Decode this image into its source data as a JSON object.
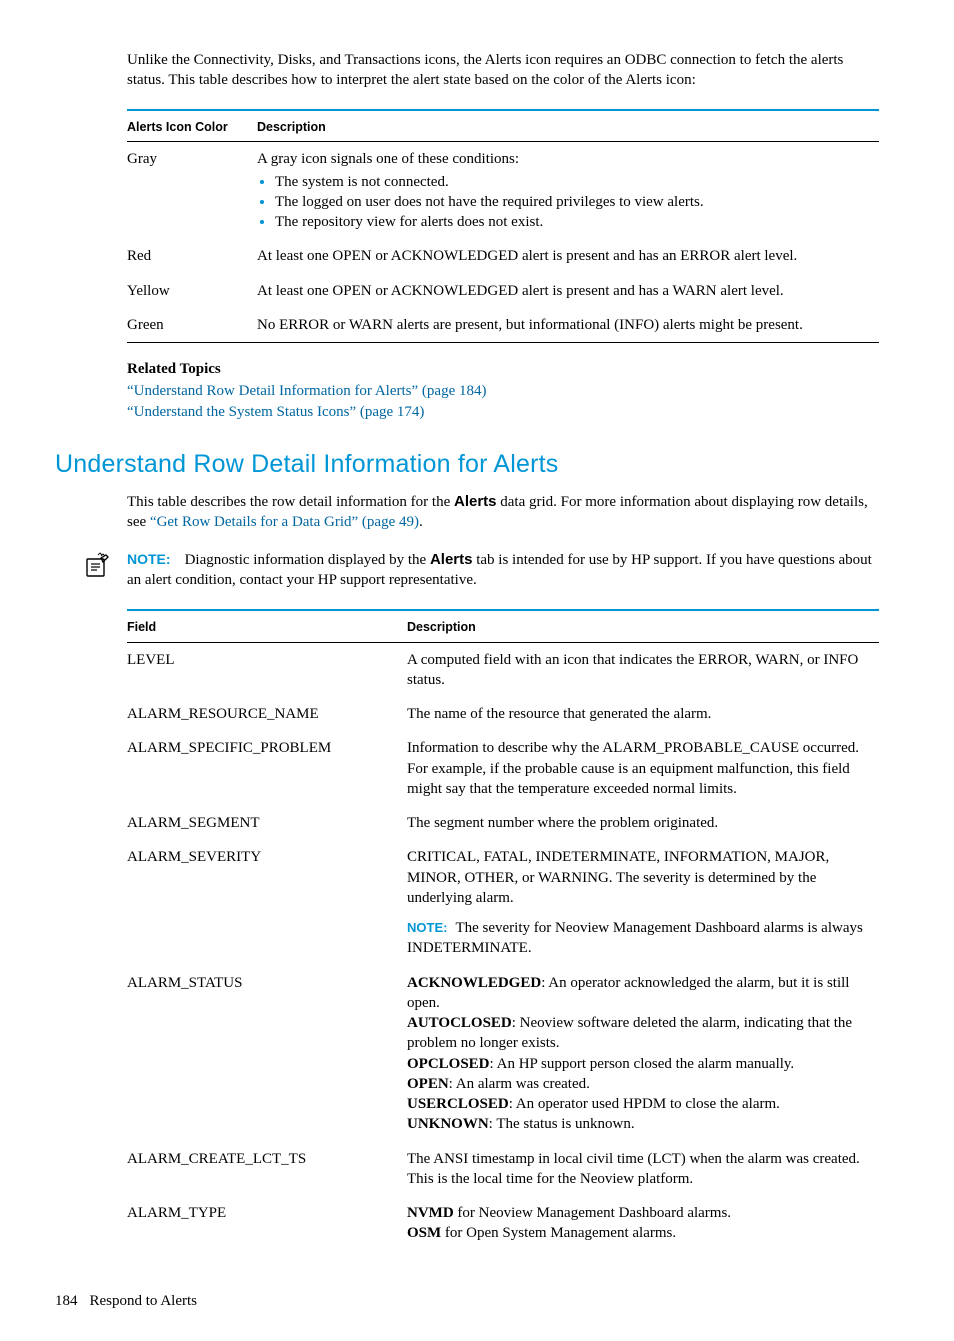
{
  "intro": "Unlike the Connectivity, Disks, and Transactions icons, the Alerts icon requires an ODBC connection to fetch the alerts status. This table describes how to interpret the alert state based on the color of the Alerts icon:",
  "table1": {
    "h1": "Alerts Icon Color",
    "h2": "Description",
    "rows": {
      "gray": {
        "color": "Gray",
        "lead": "A gray icon signals one of these conditions:",
        "b1": "The system is not connected.",
        "b2": "The logged on user does not have the required privileges to view alerts.",
        "b3": "The repository view for alerts does not exist."
      },
      "red": {
        "color": "Red",
        "desc": "At least one OPEN or ACKNOWLEDGED alert is present and has an ERROR alert level."
      },
      "yellow": {
        "color": "Yellow",
        "desc": "At least one OPEN or ACKNOWLEDGED alert is present and has a WARN alert level."
      },
      "green": {
        "color": "Green",
        "desc": "No ERROR or WARN alerts are present, but informational (INFO) alerts might be present."
      }
    }
  },
  "related": {
    "title": "Related Topics",
    "l1a": "“Understand Row Detail Information for Alerts” (page 184)",
    "l2a": "“Understand the System Status Icons” (page 174)"
  },
  "heading": "Understand Row Detail Information for Alerts",
  "body": {
    "p1a": "This table describes the row detail information for the ",
    "p1b": "Alerts",
    "p1c": " data grid. For more information about displaying row details, see ",
    "p1link": "“Get Row Details for a Data Grid” (page 49)",
    "p1d": "."
  },
  "note": {
    "label": "NOTE:",
    "t1": "Diagnostic information displayed by the ",
    "t2": "Alerts",
    "t3": " tab is intended for use by HP support. If you have questions about an alert condition, contact your HP support representative."
  },
  "table2": {
    "h1": "Field",
    "h2": "Description",
    "level": {
      "f": "LEVEL",
      "d": "A computed field with an icon that indicates the ERROR, WARN, or INFO status."
    },
    "arn": {
      "f": "ALARM_RESOURCE_NAME",
      "d": "The name of the resource that generated the alarm."
    },
    "asp": {
      "f": "ALARM_SPECIFIC_PROBLEM",
      "d": "Information to describe why the ALARM_PROBABLE_CAUSE occurred. For example, if the probable cause is an equipment malfunction, this field might say that the temperature exceeded normal limits."
    },
    "aseg": {
      "f": "ALARM_SEGMENT",
      "d": "The segment number where the problem originated."
    },
    "asev": {
      "f": "ALARM_SEVERITY",
      "d": "CRITICAL, FATAL, INDETERMINATE, INFORMATION, MAJOR, MINOR, OTHER, or WARNING. The severity is determined by the underlying alarm.",
      "noteLabel": "NOTE:",
      "note": "The severity for Neoview Management Dashboard alarms is always INDETERMINATE."
    },
    "astat": {
      "f": "ALARM_STATUS",
      "ack_b": "ACKNOWLEDGED",
      "ack_t": ": An operator acknowledged the alarm, but it is still open.",
      "auto_b": "AUTOCLOSED",
      "auto_t": ": Neoview software deleted the alarm, indicating that the problem no longer exists.",
      "op_b": "OPCLOSED",
      "op_t": ": An HP support person closed the alarm manually.",
      "open_b": "OPEN",
      "open_t": ": An alarm was created.",
      "uc_b": "USERCLOSED",
      "uc_t": ": An operator used HPDM to close the alarm.",
      "unk_b": "UNKNOWN",
      "unk_t": ": The status is unknown."
    },
    "acts": {
      "f": "ALARM_CREATE_LCT_TS",
      "d": "The ANSI timestamp in local civil time (LCT) when the alarm was created. This is the local time for the Neoview platform."
    },
    "atype": {
      "f": "ALARM_TYPE",
      "nvmd_b": "NVMD",
      "nvmd_t": " for Neoview Management Dashboard alarms.",
      "osm_b": "OSM",
      "osm_t": " for Open System Management alarms."
    }
  },
  "footer": {
    "page": "184",
    "title": "Respond to Alerts"
  }
}
